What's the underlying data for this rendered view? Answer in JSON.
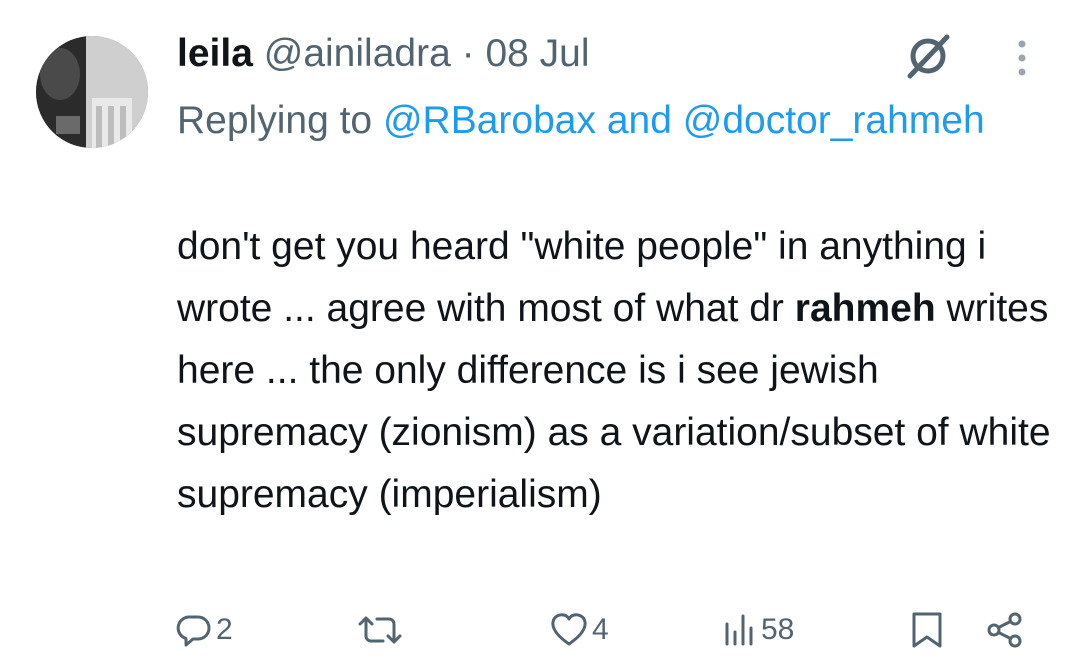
{
  "tweet": {
    "display_name": "leila",
    "handle": "@ainiladra",
    "separator": "·",
    "date": "08 Jul",
    "replying_to_label": "Replying to",
    "replying_mention_1": "@RBarobax",
    "replying_and": "and",
    "replying_mention_2": "@doctor_rahmeh",
    "text_part1": "don't get you heard \"white people\" in anything i wrote ... agree with most of what dr",
    "text_highlight": "rahmeh",
    "text_part2": "writes here ... the only difference is i see jewish supremacy (zionism) as a variation/subset of white supremacy (imperialism)"
  },
  "actions": {
    "replies": "2",
    "retweets": "",
    "likes": "4",
    "views": "58"
  },
  "icons": {
    "grok": "grok-icon",
    "more": "more-vertical-icon",
    "reply": "reply-bubble-icon",
    "retweet": "retweet-icon",
    "like": "heart-icon",
    "views": "views-chart-icon",
    "bookmark": "bookmark-icon",
    "share": "share-icon"
  },
  "colors": {
    "text": "#0f1419",
    "secondary": "#536471",
    "link": "#1d9bf0"
  }
}
